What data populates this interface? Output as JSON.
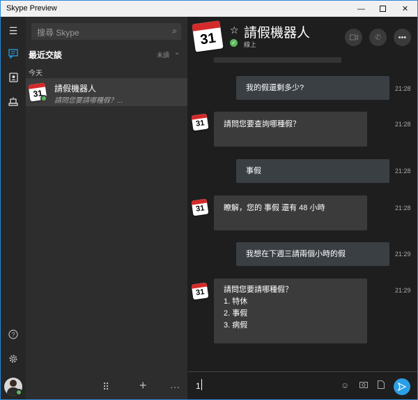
{
  "window": {
    "title": "Skype Preview"
  },
  "search": {
    "placeholder": "搜尋 Skype"
  },
  "recent": {
    "heading": "最近交談",
    "filter": "未讀",
    "group": "今天",
    "contacts": [
      {
        "name": "請假機器人",
        "preview": "請問您要請哪種假？..."
      }
    ]
  },
  "calendar_avatar": {
    "number": "31"
  },
  "chat": {
    "title": "請假機器人",
    "status": "線上",
    "messages": [
      {
        "direction": "out",
        "text": "我的假還剩多少?",
        "time": "21:28"
      },
      {
        "direction": "in",
        "text": "請問您要查詢哪種假？",
        "time": "21:28"
      },
      {
        "direction": "out",
        "text": "事假",
        "time": "21:28"
      },
      {
        "direction": "in",
        "text": "瞭解，您的 事假 還有 48 小時",
        "time": "21:28"
      },
      {
        "direction": "out",
        "text": "我想在下週三請兩個小時的假",
        "time": "21:29"
      },
      {
        "direction": "in",
        "lines": [
          "請問您要請哪種假？",
          "1. 特休",
          "2. 事假",
          "3. 病假"
        ],
        "time": "21:29"
      }
    ]
  },
  "composer": {
    "value": "1"
  },
  "icons": {
    "rail": [
      "hamburger-icon",
      "chat-icon",
      "contacts-icon",
      "bots-icon",
      "help-icon",
      "settings-icon"
    ],
    "header": [
      "video-call-icon",
      "audio-call-icon",
      "more-icon"
    ],
    "composer": [
      "emoji-icon",
      "media-icon",
      "file-icon",
      "send-icon"
    ]
  },
  "colors": {
    "accent": "#2b9fe5",
    "online": "#5cb85c",
    "calendar_red": "#d42a2a"
  }
}
